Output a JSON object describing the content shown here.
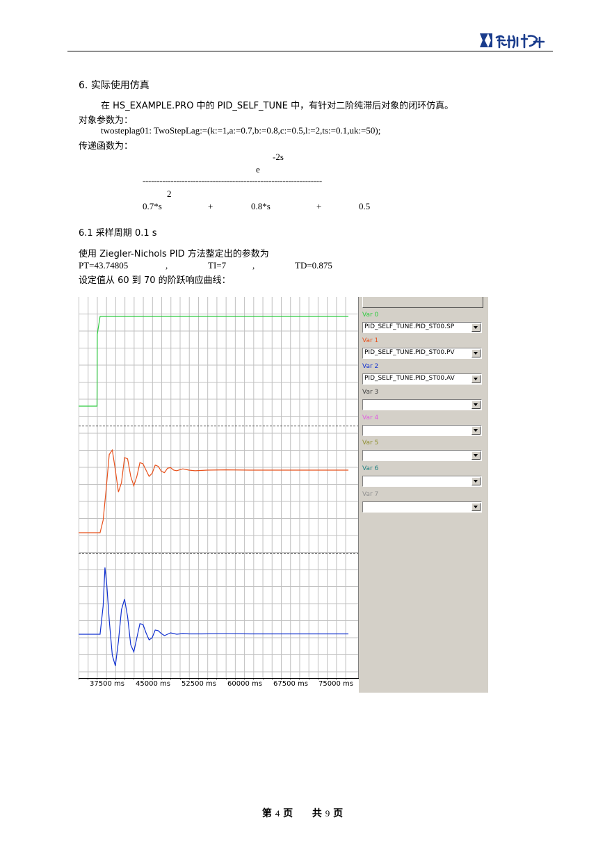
{
  "header": {
    "logo_text": "和利时"
  },
  "section": {
    "heading": "6.  实际使用仿真",
    "intro": "在 HS_EXAMPLE.PRO 中的 PID_SELF_TUNE 中，有针对二阶纯滞后对象的闭环仿真。",
    "params_label": "对象参数为：",
    "params_code": "twosteplag01: TwoStepLag:=(k:=1,a:=0.7,b:=0.8,c:=0.5,l:=2,ts:=0.1,uk:=50);",
    "transfer_label": "传递函数为："
  },
  "formula": {
    "exponent": "-2s",
    "numerator": "e",
    "fraction_line": "----------------------------------------------------------------",
    "square": "2",
    "term1": "0.7*s",
    "plus1": "+",
    "term2": "0.8*s",
    "plus2": "+",
    "term3": "0.5"
  },
  "subsection": {
    "heading": "6.1  采样周期   0.1  s",
    "method": "使用 Ziegler-Nichols PID 方法整定出的参数为",
    "pt": "PT=43.74805",
    "sep1": ",",
    "ti": "TI=7",
    "sep2": ",",
    "td": "TD=0.875",
    "curve_label": "设定值从 60 到 70 的阶跃响应曲线："
  },
  "colors": {
    "sp": "#2ecc40",
    "pv": "#e8501a",
    "av": "#1030d0",
    "var3": "#404040",
    "var4": "#e060e0",
    "var5": "#909030",
    "var6": "#208080",
    "var7": "#909090",
    "grid": "#c0c0c0"
  },
  "variables": [
    {
      "label": "Var 0",
      "value": "PID_SELF_TUNE.PID_ST00.SP"
    },
    {
      "label": "Var 1",
      "value": "PID_SELF_TUNE.PID_ST00.PV"
    },
    {
      "label": "Var 2",
      "value": "PID_SELF_TUNE.PID_ST00.AV"
    },
    {
      "label": "Var 3",
      "value": ""
    },
    {
      "label": "Var 4",
      "value": ""
    },
    {
      "label": "Var 5",
      "value": ""
    },
    {
      "label": "Var 6",
      "value": ""
    },
    {
      "label": "Var 7",
      "value": ""
    }
  ],
  "chart_data": {
    "type": "line",
    "x_ticks": [
      "37500 ms",
      "45000 ms",
      "52500 ms",
      "60000 ms",
      "67500 ms",
      "75000 ms"
    ],
    "xlim": [
      34000,
      78000
    ],
    "grid": true,
    "series": [
      {
        "name": "Var 0",
        "x": [
          34000,
          37000,
          37050,
          37500,
          38000,
          78000
        ],
        "y": [
          60,
          60,
          68,
          70,
          70,
          70
        ]
      },
      {
        "name": "Var 1",
        "x": [
          34000,
          37500,
          38000,
          38500,
          39000,
          39500,
          40000,
          40500,
          41000,
          41500,
          42000,
          42500,
          43000,
          43500,
          44000,
          44500,
          45000,
          45500,
          46000,
          46500,
          47000,
          47500,
          48000,
          48500,
          49000,
          49500,
          50000,
          51000,
          52000,
          53000,
          55000,
          58000,
          62000,
          78000
        ],
        "y": [
          60,
          60,
          62,
          67,
          72.5,
          73.2,
          70,
          66.5,
          68,
          72,
          71.8,
          69,
          67.5,
          69,
          71.2,
          71,
          70,
          69,
          69.5,
          70.8,
          70.6,
          69.8,
          69.6,
          70.3,
          70.4,
          70,
          69.9,
          70.2,
          70,
          69.9,
          70,
          70.05,
          70,
          70
        ]
      },
      {
        "name": "Var 2",
        "x": [
          34000,
          37500,
          38000,
          38300,
          38600,
          39000,
          39500,
          40000,
          40500,
          41000,
          41500,
          42000,
          42500,
          43000,
          43500,
          44000,
          44500,
          45000,
          45500,
          46000,
          46500,
          47000,
          47500,
          48000,
          48500,
          49000,
          50000,
          51000,
          52000,
          54000,
          58000,
          62000,
          78000
        ],
        "y": [
          0,
          0,
          40,
          95,
          70,
          20,
          -30,
          -45,
          -10,
          35,
          50,
          25,
          -15,
          -25,
          -5,
          15,
          14,
          2,
          -8,
          -5,
          6,
          5,
          1,
          -2,
          0,
          2,
          0,
          1,
          0.5,
          0.5,
          0.8,
          0.5,
          0.5
        ]
      }
    ]
  },
  "footer": {
    "page_label": "第",
    "page_num": "4",
    "page_unit": "页",
    "total_label": "共",
    "total_num": "9",
    "total_unit": "页"
  }
}
